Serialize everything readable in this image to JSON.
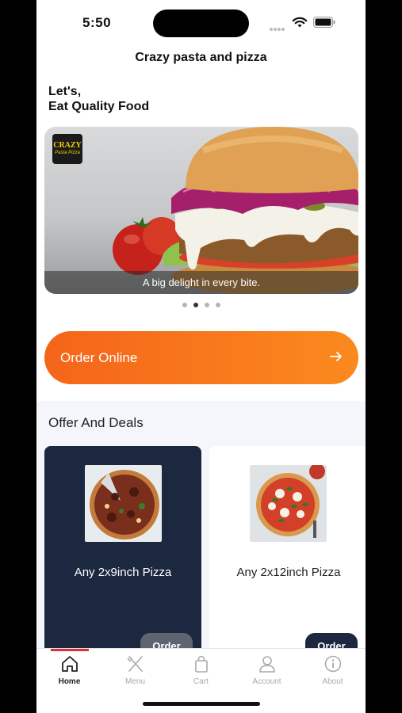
{
  "status_bar": {
    "time": "5:50"
  },
  "header": {
    "title": "Crazy pasta and pizza"
  },
  "greeting": {
    "line1": "Let's,",
    "line2": "Eat Quality Food"
  },
  "banner": {
    "logo_line1": "CRAZY",
    "logo_line2": "Pasta Pizza",
    "caption": "A big delight in every bite.",
    "slide_count": 4,
    "active_slide": 2
  },
  "order_online": {
    "label": "Order Online"
  },
  "offers": {
    "title": "Offer And Deals",
    "deals": [
      {
        "name": "Any 2x9inch Pizza",
        "button": "Order"
      },
      {
        "name": "Any 2x12inch Pizza",
        "button": "Order"
      }
    ]
  },
  "tab_bar": {
    "tabs": [
      {
        "label": "Home",
        "icon": "home-icon"
      },
      {
        "label": "Menu",
        "icon": "fork-knife-icon"
      },
      {
        "label": "Cart",
        "icon": "shopping-bag-icon"
      },
      {
        "label": "Account",
        "icon": "user-icon"
      },
      {
        "label": "About",
        "icon": "info-icon"
      }
    ],
    "active": "Home"
  },
  "colors": {
    "accent_orange": "#f5641a",
    "navy": "#1c2740",
    "active_tab_indicator": "#e0303a"
  }
}
